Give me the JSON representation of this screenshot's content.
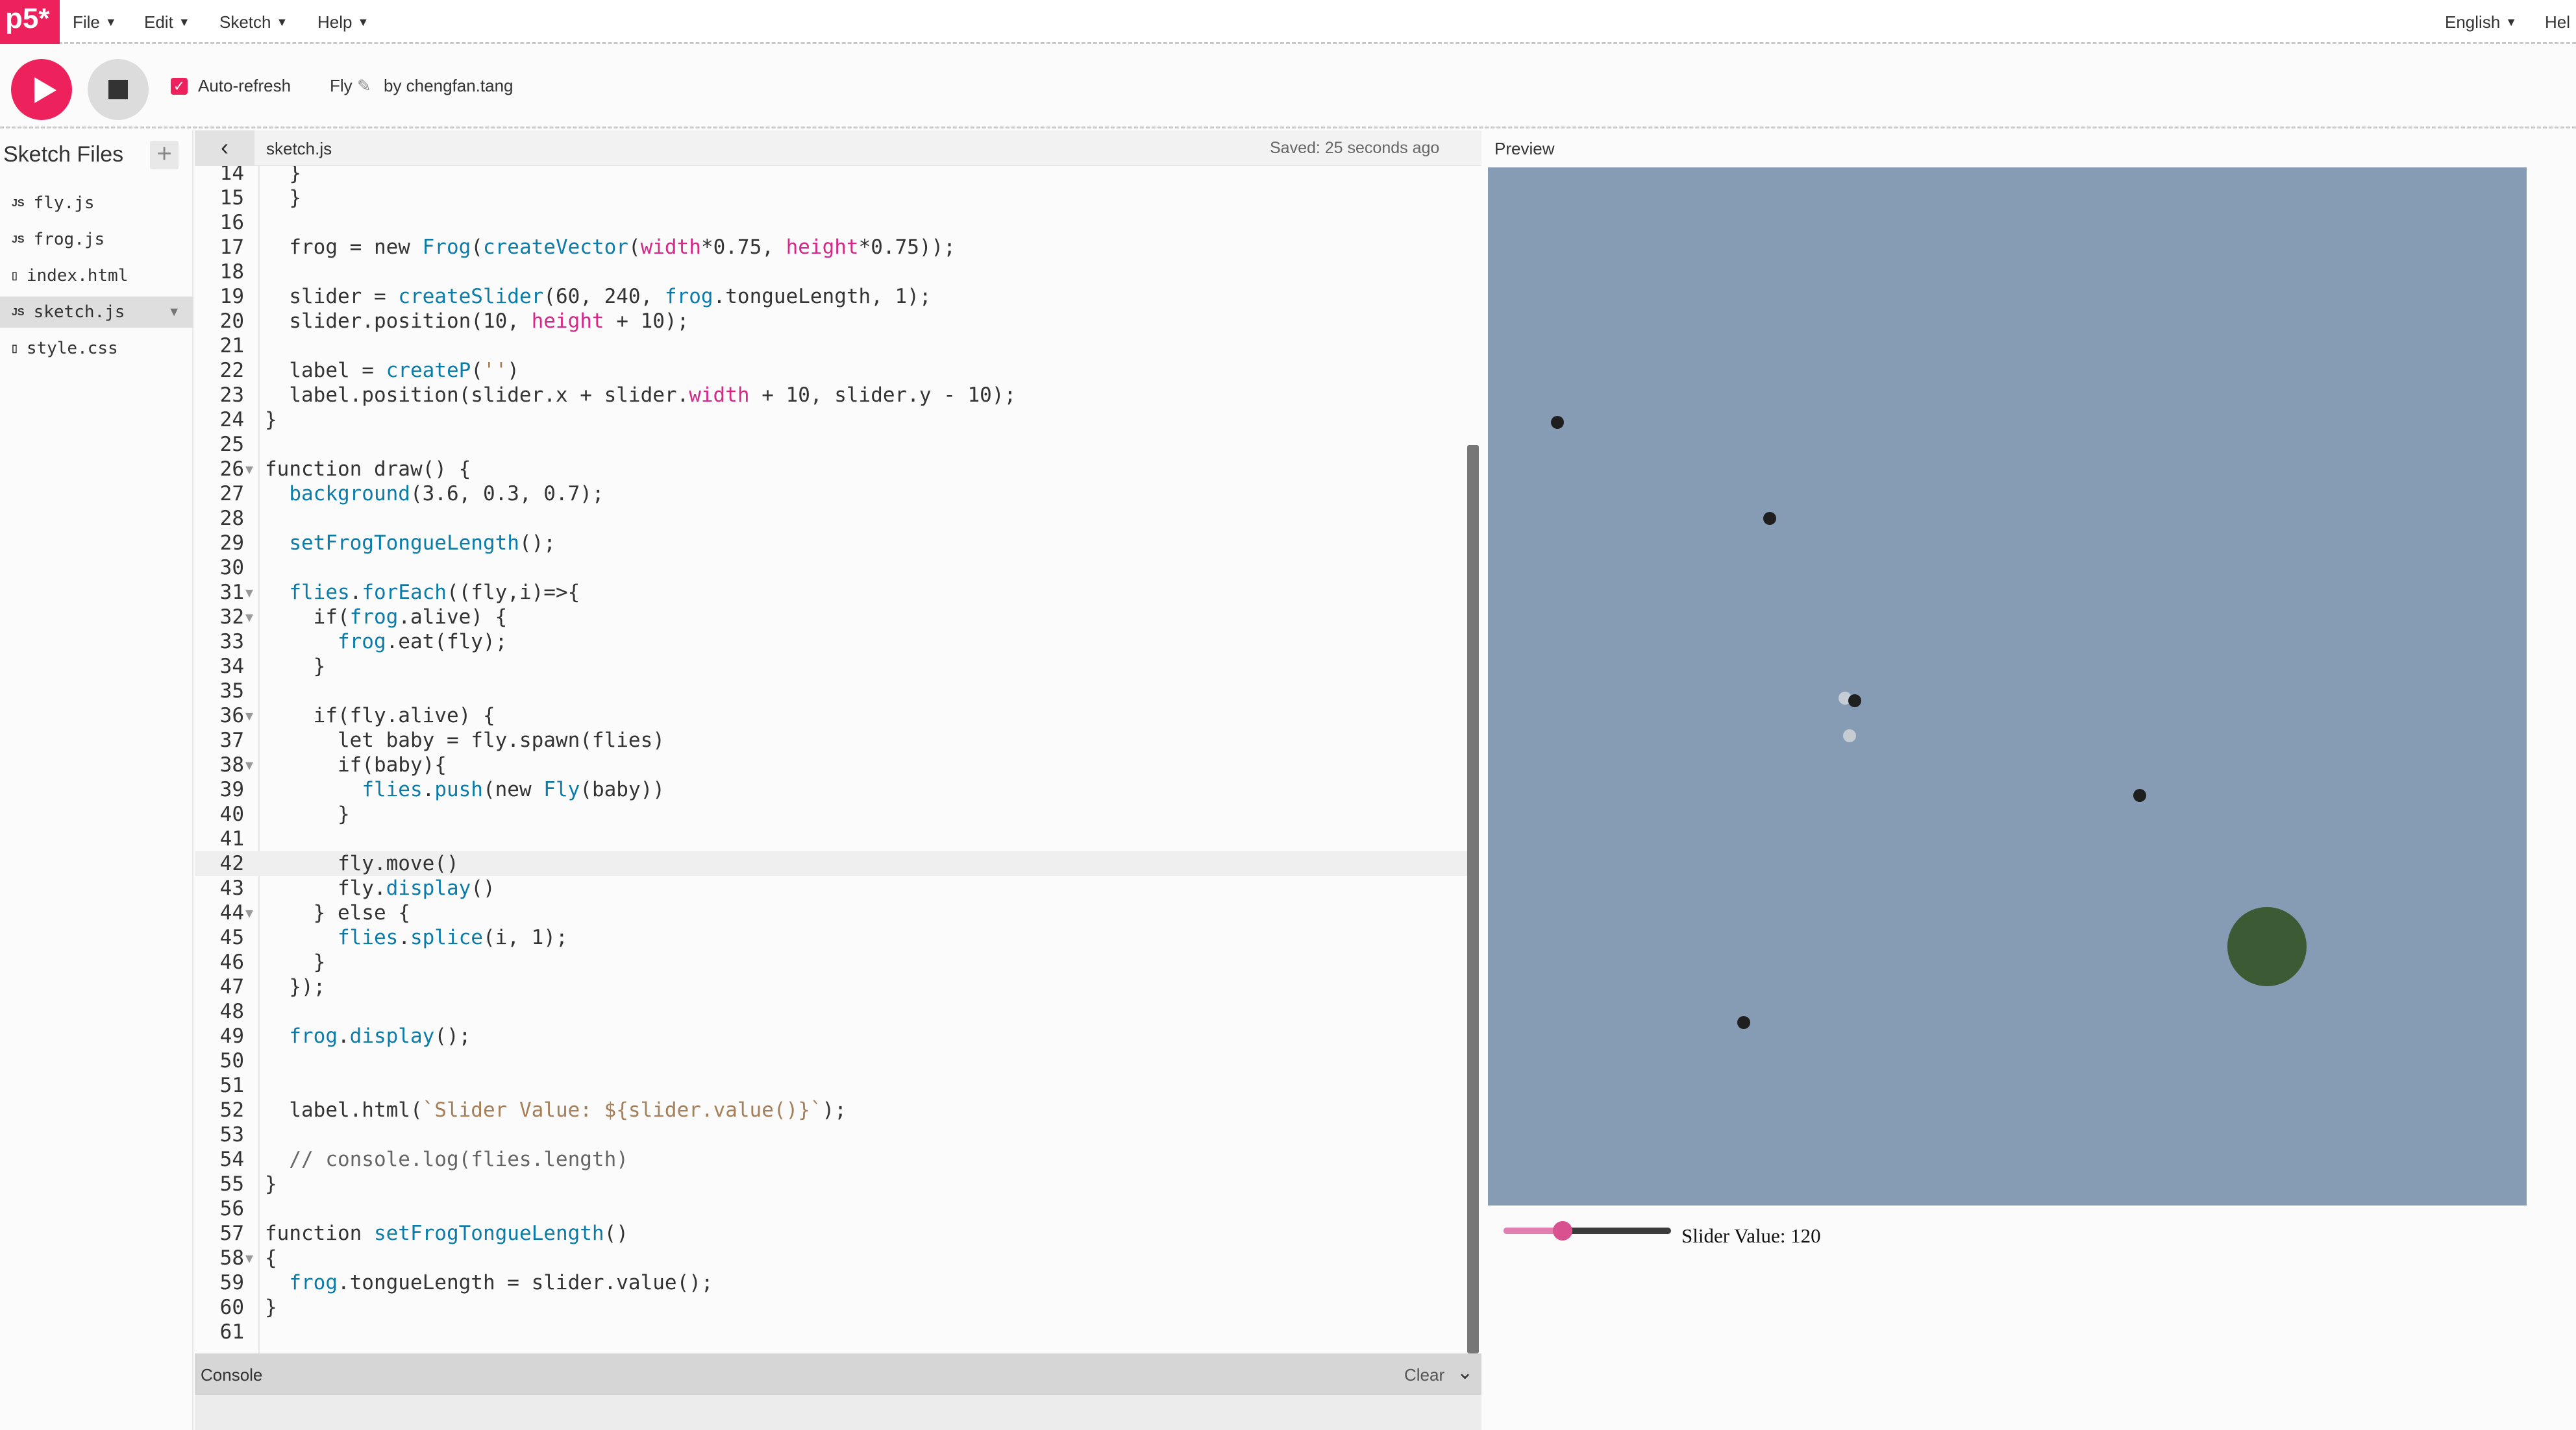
{
  "nav": {
    "logo": "p5*",
    "menus": [
      "File",
      "Edit",
      "Sketch",
      "Help"
    ],
    "language": "English",
    "help_partial": "Hel"
  },
  "toolbar": {
    "auto_refresh_label": "Auto-refresh",
    "auto_refresh_checked": true,
    "sketch_name": "Fly",
    "by_label": "by chengfan.tang"
  },
  "sidebar": {
    "title": "Sketch Files",
    "add_label": "+",
    "files": [
      {
        "icon": "JS",
        "name": "fly.js",
        "active": false
      },
      {
        "icon": "▯",
        "name": "frog.js",
        "icon_alt": "JS",
        "active": false
      },
      {
        "icon": "▯",
        "name": "index.html",
        "active": false
      },
      {
        "icon": "JS",
        "name": "sketch.js",
        "active": true
      },
      {
        "icon": "▯",
        "name": "style.css",
        "active": false
      }
    ]
  },
  "editor": {
    "file_name": "sketch.js",
    "saved_status": "Saved: 25 seconds ago",
    "active_line": 42,
    "lines": [
      {
        "n": "14",
        "code": "  }"
      },
      {
        "n": "15",
        "code": "  }"
      },
      {
        "n": "16",
        "code": ""
      },
      {
        "n": "17",
        "code": "  frog = new Frog(createVector(width*0.75, height*0.75));"
      },
      {
        "n": "18",
        "code": ""
      },
      {
        "n": "19",
        "code": "  slider = createSlider(60, 240, frog.tongueLength, 1);"
      },
      {
        "n": "20",
        "code": "  slider.position(10, height + 10);"
      },
      {
        "n": "21",
        "code": ""
      },
      {
        "n": "22",
        "code": "  label = createP('')"
      },
      {
        "n": "23",
        "code": "  label.position(slider.x + slider.width + 10, slider.y - 10);"
      },
      {
        "n": "24",
        "code": "}"
      },
      {
        "n": "25",
        "code": ""
      },
      {
        "n": "26",
        "code": "function draw() {",
        "fold": true
      },
      {
        "n": "27",
        "code": "  background(3.6, 0.3, 0.7);"
      },
      {
        "n": "28",
        "code": ""
      },
      {
        "n": "29",
        "code": "  setFrogTongueLength();"
      },
      {
        "n": "30",
        "code": ""
      },
      {
        "n": "31",
        "code": "  flies.forEach((fly,i)=>{",
        "fold": true
      },
      {
        "n": "32",
        "code": "    if(frog.alive) {",
        "fold": true
      },
      {
        "n": "33",
        "code": "      frog.eat(fly);"
      },
      {
        "n": "34",
        "code": "    }"
      },
      {
        "n": "35",
        "code": ""
      },
      {
        "n": "36",
        "code": "    if(fly.alive) {",
        "fold": true
      },
      {
        "n": "37",
        "code": "      let baby = fly.spawn(flies)"
      },
      {
        "n": "38",
        "code": "      if(baby){",
        "fold": true
      },
      {
        "n": "39",
        "code": "        flies.push(new Fly(baby))"
      },
      {
        "n": "40",
        "code": "      }"
      },
      {
        "n": "41",
        "code": ""
      },
      {
        "n": "42",
        "code": "      fly.move()"
      },
      {
        "n": "43",
        "code": "      fly.display()"
      },
      {
        "n": "44",
        "code": "    } else {",
        "fold": true
      },
      {
        "n": "45",
        "code": "      flies.splice(i, 1);"
      },
      {
        "n": "46",
        "code": "    }"
      },
      {
        "n": "47",
        "code": "  });"
      },
      {
        "n": "48",
        "code": ""
      },
      {
        "n": "49",
        "code": "  frog.display();"
      },
      {
        "n": "50",
        "code": ""
      },
      {
        "n": "51",
        "code": ""
      },
      {
        "n": "52",
        "code": "  label.html(`Slider Value: ${slider.value()}`);"
      },
      {
        "n": "53",
        "code": ""
      },
      {
        "n": "54",
        "code": "  // console.log(flies.length)"
      },
      {
        "n": "55",
        "code": "}"
      },
      {
        "n": "56",
        "code": ""
      },
      {
        "n": "57",
        "code": "function setFrogTongueLength()"
      },
      {
        "n": "58",
        "code": "{",
        "fold": true
      },
      {
        "n": "59",
        "code": "  frog.tongueLength = slider.value();"
      },
      {
        "n": "60",
        "code": "}"
      },
      {
        "n": "61",
        "code": ""
      }
    ]
  },
  "console": {
    "title": "Console",
    "clear_label": "Clear"
  },
  "preview": {
    "title": "Preview",
    "canvas_color": "#869bb4",
    "fly_color": "#1f1f1f",
    "frog_color": "#3c5a33",
    "slider_min": 60,
    "slider_max": 240,
    "slider_value": 120,
    "slider_label": "Slider Value: 120"
  },
  "colors": {
    "accent": "#ed225d"
  }
}
